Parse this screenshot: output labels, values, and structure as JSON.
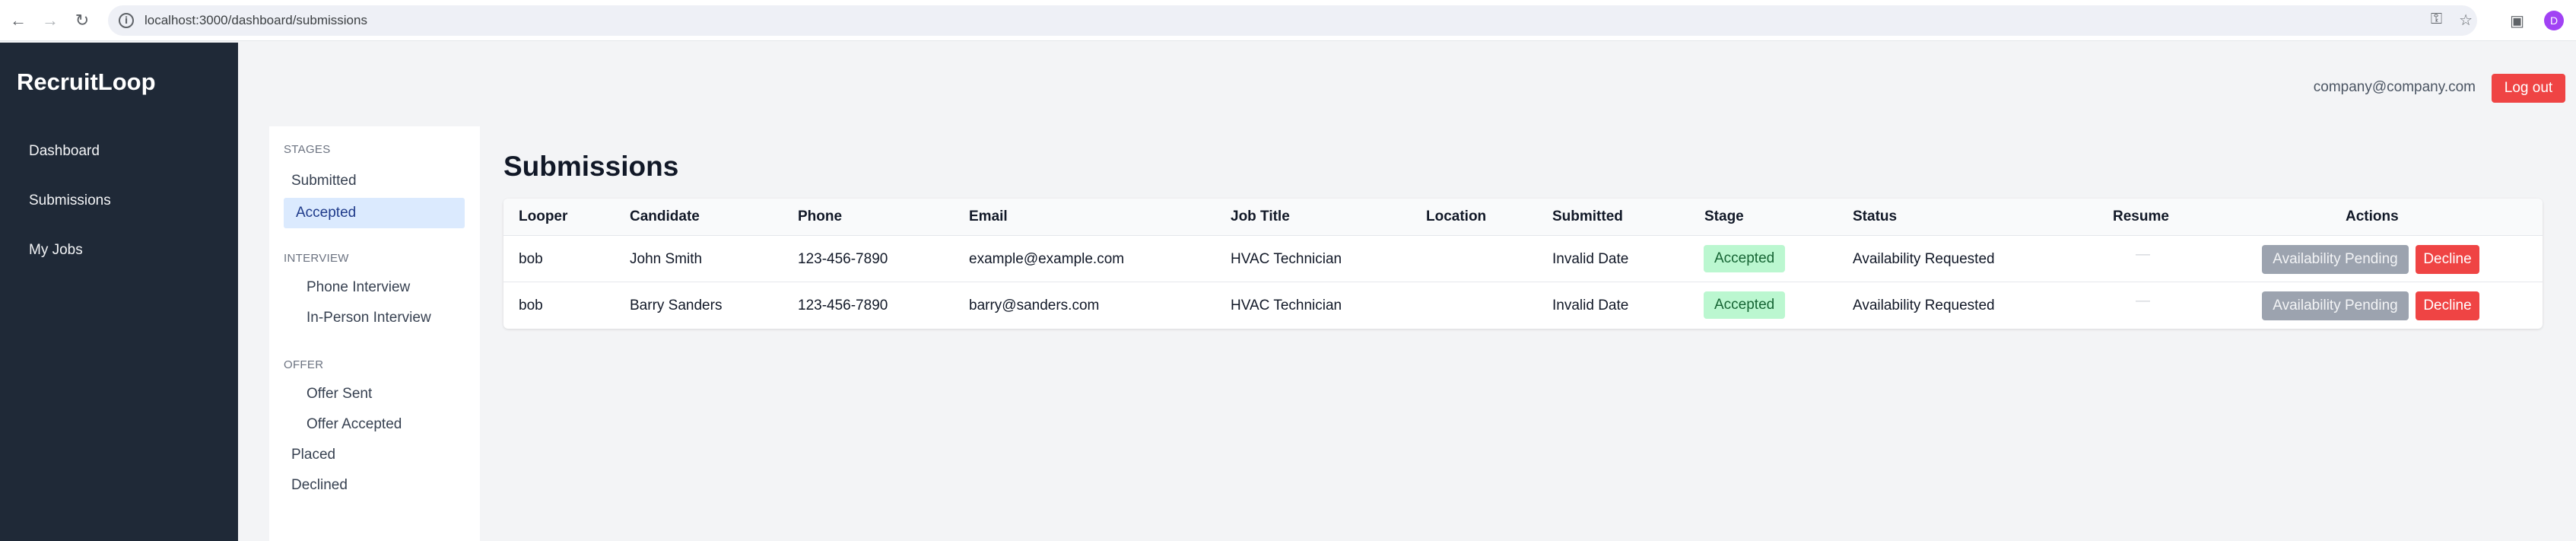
{
  "browser": {
    "url": "localhost:3000/dashboard/submissions",
    "profile_initial": "D"
  },
  "app": {
    "brand": "RecruitLoop",
    "nav": [
      {
        "label": "Dashboard"
      },
      {
        "label": "Submissions"
      },
      {
        "label": "My Jobs"
      }
    ],
    "user_email": "company@company.com",
    "logout_label": "Log out"
  },
  "stages_panel": {
    "stages_heading": "STAGES",
    "submitted": "Submitted",
    "accepted": "Accepted",
    "interview_heading": "INTERVIEW",
    "phone_interview": "Phone Interview",
    "in_person_interview": "In-Person Interview",
    "offer_heading": "OFFER",
    "offer_sent": "Offer Sent",
    "offer_accepted": "Offer Accepted",
    "placed": "Placed",
    "declined": "Declined"
  },
  "page": {
    "title": "Submissions"
  },
  "table": {
    "headers": {
      "looper": "Looper",
      "candidate": "Candidate",
      "phone": "Phone",
      "email": "Email",
      "job_title": "Job Title",
      "location": "Location",
      "submitted": "Submitted",
      "stage": "Stage",
      "status": "Status",
      "resume": "Resume",
      "actions": "Actions"
    },
    "rows": [
      {
        "looper": "bob",
        "candidate": "John Smith",
        "phone": "123-456-7890",
        "email": "example@example.com",
        "job_title": "HVAC Technician",
        "location": "",
        "submitted": "Invalid Date",
        "stage": "Accepted",
        "status": "Availability Requested",
        "resume": "—",
        "pending_label": "Availability Pending",
        "decline_label": "Decline"
      },
      {
        "looper": "bob",
        "candidate": "Barry Sanders",
        "phone": "123-456-7890",
        "email": "barry@sanders.com",
        "job_title": "HVAC Technician",
        "location": "",
        "submitted": "Invalid Date",
        "stage": "Accepted",
        "status": "Availability Requested",
        "resume": "—",
        "pending_label": "Availability Pending",
        "decline_label": "Decline"
      }
    ]
  },
  "colors": {
    "sidebar_bg": "#1f2937",
    "accent_danger": "#ef4444",
    "badge_accepted_bg": "#bbf7d0",
    "active_stage_bg": "#dbeafe"
  }
}
